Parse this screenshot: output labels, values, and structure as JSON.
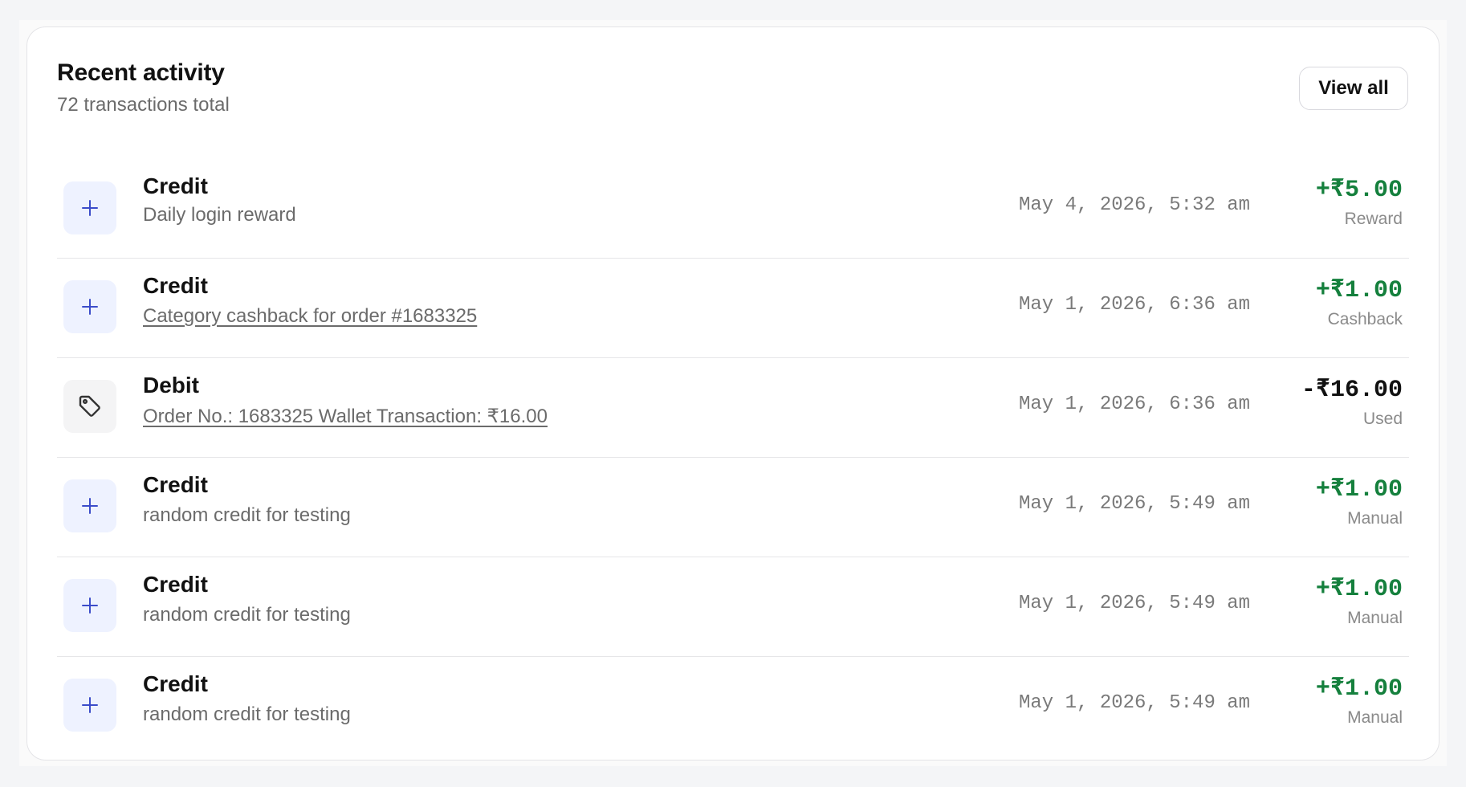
{
  "header": {
    "title": "Recent activity",
    "subtitle": "72 transactions total",
    "view_all_label": "View all"
  },
  "colors": {
    "positive_amount": "#15803d",
    "negative_amount": "#111111",
    "credit_icon_bg": "#eef2ff",
    "credit_icon_color": "#3b4cca",
    "debit_icon_bg": "#f4f4f5"
  },
  "transactions": [
    {
      "type": "Credit",
      "icon": "plus-icon",
      "description": "Daily login reward",
      "description_is_link": false,
      "date": "May 4, 2026, 5:32 am",
      "amount": "+₹5.00",
      "category": "Reward"
    },
    {
      "type": "Credit",
      "icon": "plus-icon",
      "description": "Category cashback for order #1683325",
      "description_is_link": true,
      "date": "May 1, 2026, 6:36 am",
      "amount": "+₹1.00",
      "category": "Cashback"
    },
    {
      "type": "Debit",
      "icon": "tag-icon",
      "description": "Order No.: 1683325 Wallet Transaction: ₹16.00",
      "description_is_link": true,
      "date": "May 1, 2026, 6:36 am",
      "amount": "-₹16.00",
      "category": "Used"
    },
    {
      "type": "Credit",
      "icon": "plus-icon",
      "description": "random credit for testing",
      "description_is_link": false,
      "date": "May 1, 2026, 5:49 am",
      "amount": "+₹1.00",
      "category": "Manual"
    },
    {
      "type": "Credit",
      "icon": "plus-icon",
      "description": "random credit for testing",
      "description_is_link": false,
      "date": "May 1, 2026, 5:49 am",
      "amount": "+₹1.00",
      "category": "Manual"
    },
    {
      "type": "Credit",
      "icon": "plus-icon",
      "description": "random credit for testing",
      "description_is_link": false,
      "date": "May 1, 2026, 5:49 am",
      "amount": "+₹1.00",
      "category": "Manual"
    }
  ]
}
